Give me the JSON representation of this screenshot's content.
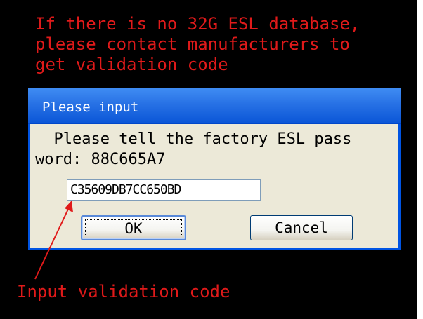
{
  "warning": {
    "text": "If there is no 32G ESL database,\nplease contact manufacturers to\nget validation code"
  },
  "dialog": {
    "title": "Please input",
    "prompt": "  Please tell the factory ESL pass\nword: 88C665A7",
    "input_value": "C35609DB7CC650BD",
    "ok_label": "OK",
    "cancel_label": "Cancel"
  },
  "annotation": {
    "text": "Input validation code"
  },
  "colors": {
    "annotation_red": "#e01a1a",
    "titlebar_blue": "#0a56d7",
    "dialog_face": "#ece9d8"
  }
}
